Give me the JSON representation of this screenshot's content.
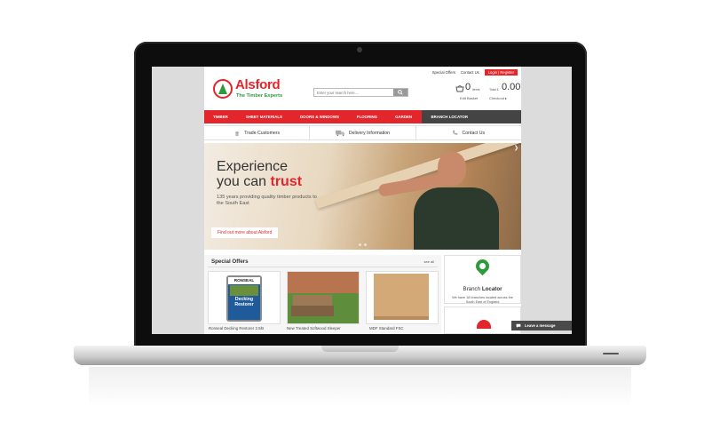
{
  "utility_nav": {
    "special_offers": "Special Offers",
    "contact_us": "Contact Us",
    "login": "Login",
    "register": "Register",
    "divider": "|"
  },
  "header": {
    "brand": "Alsford",
    "tagline": "The Timber Experts",
    "search_placeholder": "Enter your search here....",
    "basket_count": "0",
    "basket_items_label": "items",
    "edit_basket": "Edit Basket",
    "total_label": "Total £",
    "total_value": "0.00",
    "checkout": "Checkout"
  },
  "nav": {
    "items": [
      "TIMBER",
      "SHEET MATERIALS",
      "DOORS & WINDOWS",
      "FLOORING",
      "GARDEN",
      "BRANCH LOCATOR"
    ]
  },
  "info_bar": {
    "trade": "Trade Customers",
    "delivery": "Delivery Information",
    "contact": "Contact Us"
  },
  "hero": {
    "line1": "Experience",
    "line2_pre": "you can ",
    "line2_accent": "trust",
    "subtitle": "135 years providing quality timber products to the South East",
    "cta": "Find out more about Alsford"
  },
  "offers": {
    "title": "Special Offers",
    "see_all": "see all",
    "products": [
      {
        "name": "Ronseal Decking Restorer 2.5ltr",
        "label_brand": "RONSEAL",
        "label_product": "Decking Restorer"
      },
      {
        "name": "New Treated Softwood Sleeper"
      },
      {
        "name": "MDF Standard FSC"
      }
    ]
  },
  "branch": {
    "title_pre": "Branch ",
    "title_bold": "Locator",
    "desc": "We have 18 branches located across the South East of England"
  },
  "chat": {
    "label": "Leave a message"
  },
  "colors": {
    "brand_red": "#e3262c",
    "brand_green": "#2e9a3b",
    "nav_dark": "#444444"
  }
}
